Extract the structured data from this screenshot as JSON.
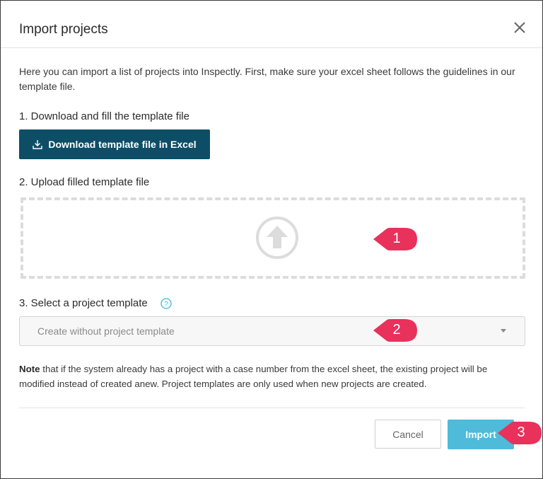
{
  "dialog": {
    "title": "Import projects",
    "intro": "Here you can import a list of projects into Inspectly. First, make sure your excel sheet follows the guidelines in our template file."
  },
  "step1": {
    "label": "1. Download and fill the template file",
    "button_label": "Download template file in Excel",
    "button_icon": "download-icon"
  },
  "step2": {
    "label": "2. Upload filled template file",
    "dropzone_icon": "upload-arrow-icon"
  },
  "step3": {
    "label": "3. Select a project template",
    "help_icon": "question-circle-icon",
    "select_value": "Create without project template"
  },
  "note": {
    "bold": "Note",
    "text": " that if the system already has a project with a case number from the excel sheet, the existing project will be modified instead of created anew. Project templates are only used when new projects are created."
  },
  "footer": {
    "cancel_label": "Cancel",
    "import_label": "Import"
  },
  "callouts": [
    "1",
    "2",
    "3"
  ],
  "colors": {
    "primary_dark": "#0d4e66",
    "import_button": "#4dbbd9",
    "callout": "#e8315b",
    "help_icon": "#3fb8d6"
  }
}
